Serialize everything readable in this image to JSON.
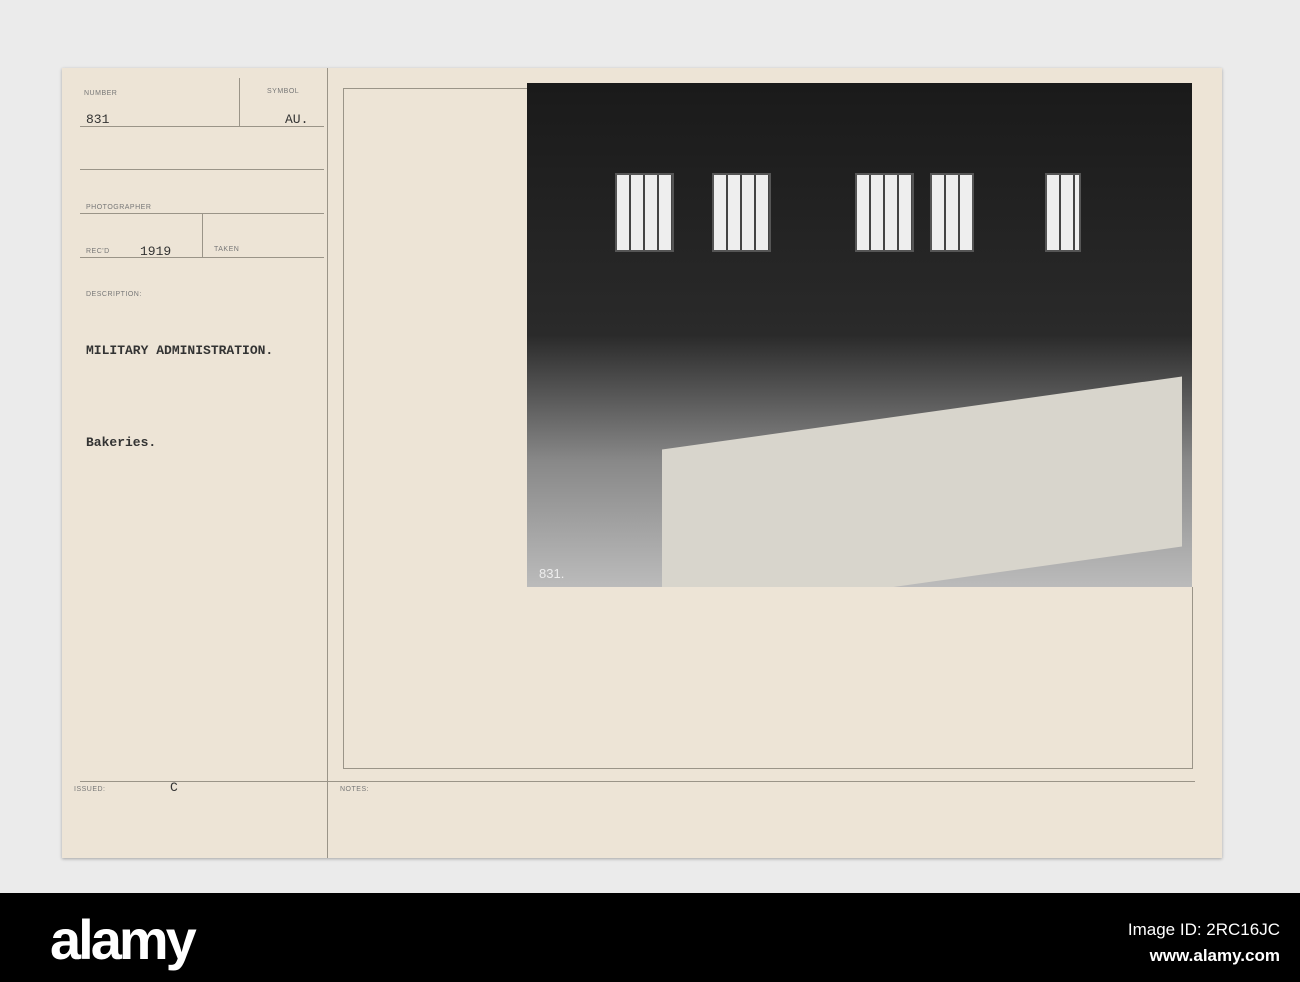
{
  "card": {
    "number_label": "NUMBER",
    "number": "831",
    "symbol_label": "SYMBOL",
    "symbol": "AU.",
    "photographer_label": "PHOTOGRAPHER",
    "recd_label": "REC'D",
    "recd": "1919",
    "taken_label": "TAKEN",
    "description_label": "DESCRIPTION:",
    "description_title": "MILITARY ADMINISTRATION.",
    "description_sub": "Bakeries.",
    "issued_label": "ISSUED:",
    "issued": "C",
    "notes_label": "NOTES:",
    "photo_number": "831."
  },
  "footer": {
    "logo": "alamy",
    "image_id": "Image ID: 2RC16JC",
    "url": "www.alamy.com"
  }
}
